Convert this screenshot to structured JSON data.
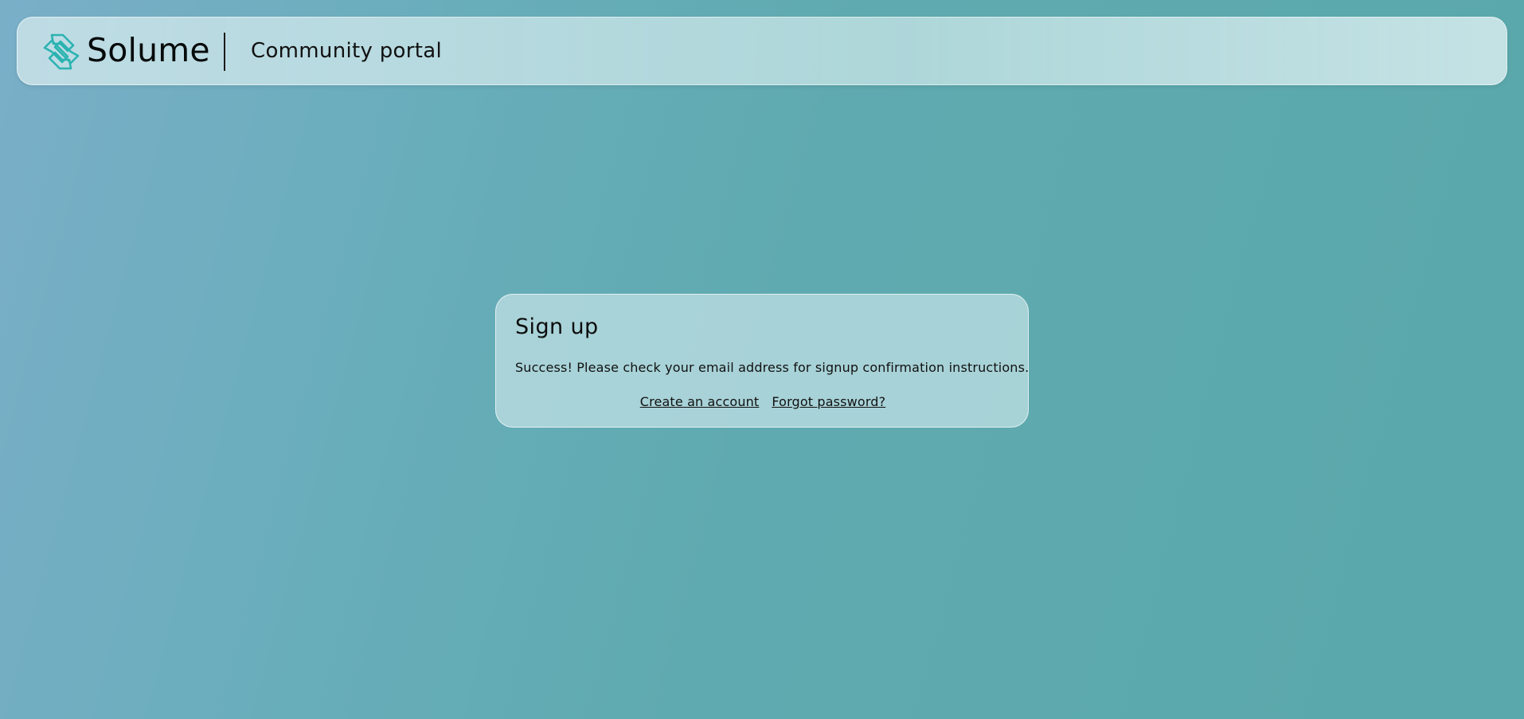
{
  "header": {
    "brand_name": "Solume",
    "portal_title": "Community portal",
    "logo_icon": "solume-logo-icon",
    "accent_color": "#2bb3b1"
  },
  "signup_card": {
    "title": "Sign up",
    "message": "Success! Please check your email address for signup confirmation instructions.",
    "links": {
      "create_account": "Create an account",
      "forgot_password": "Forgot password?"
    }
  }
}
